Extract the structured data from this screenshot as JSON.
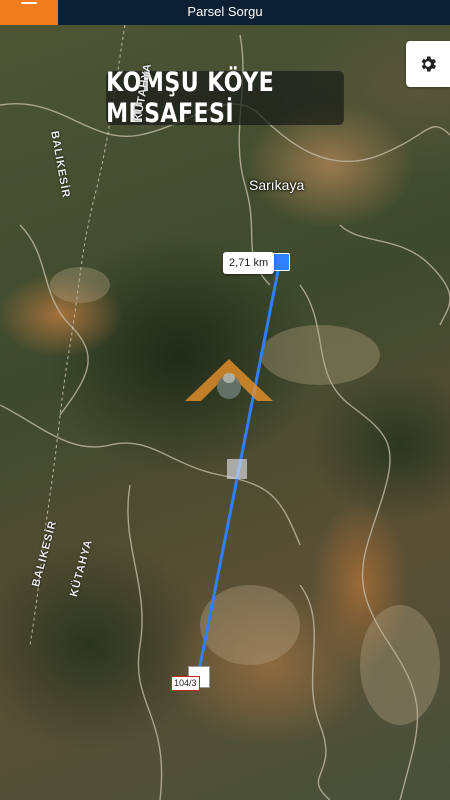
{
  "header": {
    "title": "Parsel Sorgu",
    "menu_icon": "hamburger-icon",
    "accent_color": "#f07c1d",
    "bar_color": "#0c1f33"
  },
  "map": {
    "banner_title": "KOMŞU KÖYE MESAFESİ",
    "settings_icon": "gear-icon",
    "village_name": "Sarıkaya",
    "distance_label": "2,71 km",
    "parcel_label": "104/3",
    "border_labels": {
      "north_left": "BALIKESİR",
      "north_right": "KÜTAHYA",
      "south_left": "BALIKESİR",
      "south_right": "KÜTAHYA"
    },
    "line_color": "#2f80ff"
  }
}
